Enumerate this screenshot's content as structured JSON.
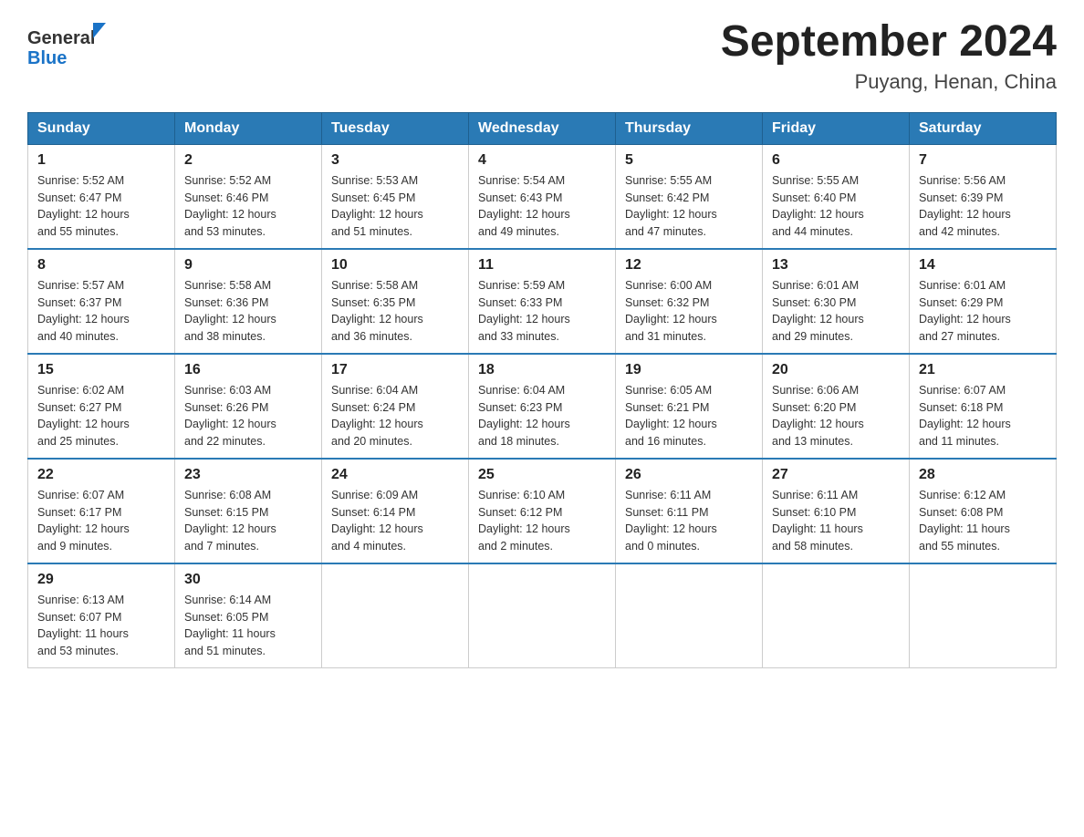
{
  "header": {
    "logo_general": "General",
    "logo_blue": "Blue",
    "title": "September 2024",
    "location": "Puyang, Henan, China"
  },
  "columns": [
    "Sunday",
    "Monday",
    "Tuesday",
    "Wednesday",
    "Thursday",
    "Friday",
    "Saturday"
  ],
  "weeks": [
    [
      {
        "day": "1",
        "sunrise": "5:52 AM",
        "sunset": "6:47 PM",
        "daylight": "12 hours and 55 minutes."
      },
      {
        "day": "2",
        "sunrise": "5:52 AM",
        "sunset": "6:46 PM",
        "daylight": "12 hours and 53 minutes."
      },
      {
        "day": "3",
        "sunrise": "5:53 AM",
        "sunset": "6:45 PM",
        "daylight": "12 hours and 51 minutes."
      },
      {
        "day": "4",
        "sunrise": "5:54 AM",
        "sunset": "6:43 PM",
        "daylight": "12 hours and 49 minutes."
      },
      {
        "day": "5",
        "sunrise": "5:55 AM",
        "sunset": "6:42 PM",
        "daylight": "12 hours and 47 minutes."
      },
      {
        "day": "6",
        "sunrise": "5:55 AM",
        "sunset": "6:40 PM",
        "daylight": "12 hours and 44 minutes."
      },
      {
        "day": "7",
        "sunrise": "5:56 AM",
        "sunset": "6:39 PM",
        "daylight": "12 hours and 42 minutes."
      }
    ],
    [
      {
        "day": "8",
        "sunrise": "5:57 AM",
        "sunset": "6:37 PM",
        "daylight": "12 hours and 40 minutes."
      },
      {
        "day": "9",
        "sunrise": "5:58 AM",
        "sunset": "6:36 PM",
        "daylight": "12 hours and 38 minutes."
      },
      {
        "day": "10",
        "sunrise": "5:58 AM",
        "sunset": "6:35 PM",
        "daylight": "12 hours and 36 minutes."
      },
      {
        "day": "11",
        "sunrise": "5:59 AM",
        "sunset": "6:33 PM",
        "daylight": "12 hours and 33 minutes."
      },
      {
        "day": "12",
        "sunrise": "6:00 AM",
        "sunset": "6:32 PM",
        "daylight": "12 hours and 31 minutes."
      },
      {
        "day": "13",
        "sunrise": "6:01 AM",
        "sunset": "6:30 PM",
        "daylight": "12 hours and 29 minutes."
      },
      {
        "day": "14",
        "sunrise": "6:01 AM",
        "sunset": "6:29 PM",
        "daylight": "12 hours and 27 minutes."
      }
    ],
    [
      {
        "day": "15",
        "sunrise": "6:02 AM",
        "sunset": "6:27 PM",
        "daylight": "12 hours and 25 minutes."
      },
      {
        "day": "16",
        "sunrise": "6:03 AM",
        "sunset": "6:26 PM",
        "daylight": "12 hours and 22 minutes."
      },
      {
        "day": "17",
        "sunrise": "6:04 AM",
        "sunset": "6:24 PM",
        "daylight": "12 hours and 20 minutes."
      },
      {
        "day": "18",
        "sunrise": "6:04 AM",
        "sunset": "6:23 PM",
        "daylight": "12 hours and 18 minutes."
      },
      {
        "day": "19",
        "sunrise": "6:05 AM",
        "sunset": "6:21 PM",
        "daylight": "12 hours and 16 minutes."
      },
      {
        "day": "20",
        "sunrise": "6:06 AM",
        "sunset": "6:20 PM",
        "daylight": "12 hours and 13 minutes."
      },
      {
        "day": "21",
        "sunrise": "6:07 AM",
        "sunset": "6:18 PM",
        "daylight": "12 hours and 11 minutes."
      }
    ],
    [
      {
        "day": "22",
        "sunrise": "6:07 AM",
        "sunset": "6:17 PM",
        "daylight": "12 hours and 9 minutes."
      },
      {
        "day": "23",
        "sunrise": "6:08 AM",
        "sunset": "6:15 PM",
        "daylight": "12 hours and 7 minutes."
      },
      {
        "day": "24",
        "sunrise": "6:09 AM",
        "sunset": "6:14 PM",
        "daylight": "12 hours and 4 minutes."
      },
      {
        "day": "25",
        "sunrise": "6:10 AM",
        "sunset": "6:12 PM",
        "daylight": "12 hours and 2 minutes."
      },
      {
        "day": "26",
        "sunrise": "6:11 AM",
        "sunset": "6:11 PM",
        "daylight": "12 hours and 0 minutes."
      },
      {
        "day": "27",
        "sunrise": "6:11 AM",
        "sunset": "6:10 PM",
        "daylight": "11 hours and 58 minutes."
      },
      {
        "day": "28",
        "sunrise": "6:12 AM",
        "sunset": "6:08 PM",
        "daylight": "11 hours and 55 minutes."
      }
    ],
    [
      {
        "day": "29",
        "sunrise": "6:13 AM",
        "sunset": "6:07 PM",
        "daylight": "11 hours and 53 minutes."
      },
      {
        "day": "30",
        "sunrise": "6:14 AM",
        "sunset": "6:05 PM",
        "daylight": "11 hours and 51 minutes."
      },
      null,
      null,
      null,
      null,
      null
    ]
  ],
  "labels": {
    "sunrise": "Sunrise:",
    "sunset": "Sunset:",
    "daylight": "Daylight:"
  }
}
